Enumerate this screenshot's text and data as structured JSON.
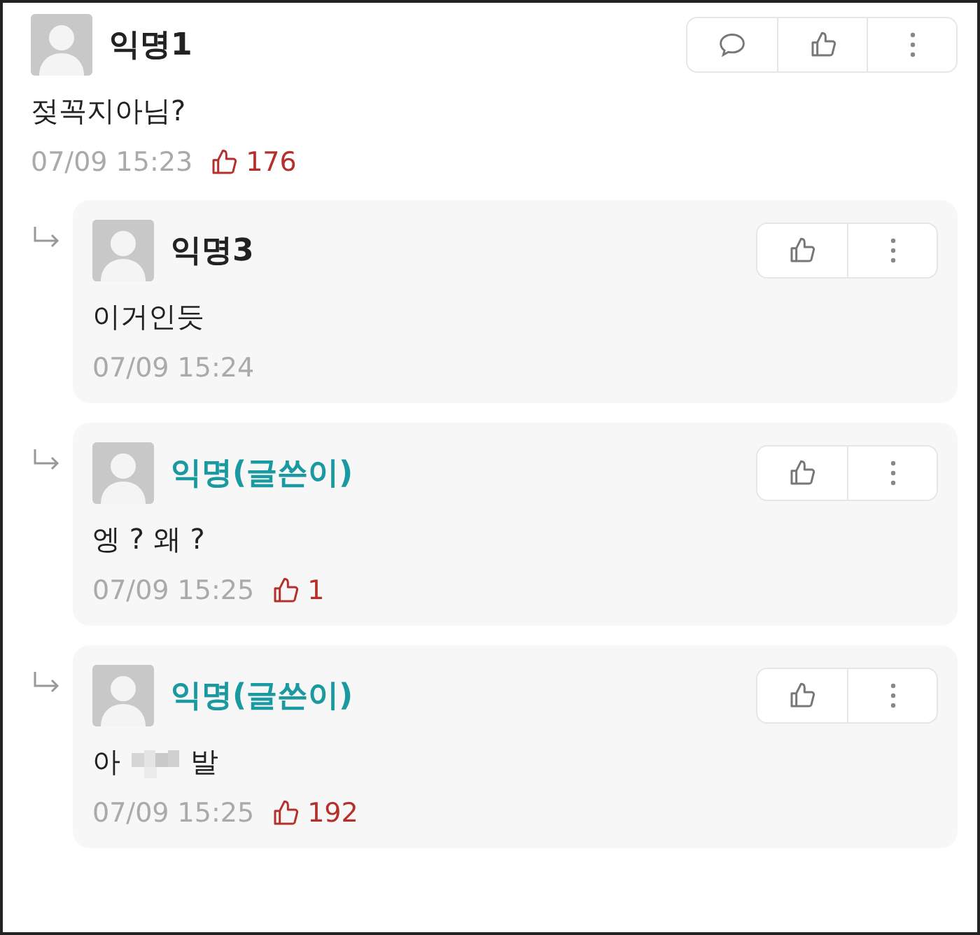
{
  "comment": {
    "author": "익명1",
    "is_writer": false,
    "body": [
      {
        "kind": "text",
        "text": "젖꼭지아님?"
      }
    ],
    "time": "07/09 15:23",
    "likes": "176",
    "actions": [
      {
        "kind": "reply"
      },
      {
        "kind": "like"
      },
      {
        "kind": "more"
      }
    ]
  },
  "replies": [
    {
      "author": "익명3",
      "is_writer": false,
      "body": [
        {
          "kind": "text",
          "text": "이거인듯"
        }
      ],
      "time": "07/09 15:24",
      "actions": [
        {
          "kind": "like"
        },
        {
          "kind": "more"
        }
      ]
    },
    {
      "author": "익명(글쓴이)",
      "is_writer": true,
      "body": [
        {
          "kind": "text",
          "text": "엥 ? 왜 ?"
        }
      ],
      "time": "07/09 15:25",
      "likes": "1",
      "actions": [
        {
          "kind": "like"
        },
        {
          "kind": "more"
        }
      ]
    },
    {
      "author": "익명(글쓴이)",
      "is_writer": true,
      "body": [
        {
          "kind": "text",
          "text": "아"
        },
        {
          "kind": "censored"
        },
        {
          "kind": "text",
          "text": "발"
        }
      ],
      "time": "07/09 15:25",
      "likes": "192",
      "actions": [
        {
          "kind": "like"
        },
        {
          "kind": "more"
        }
      ]
    }
  ]
}
